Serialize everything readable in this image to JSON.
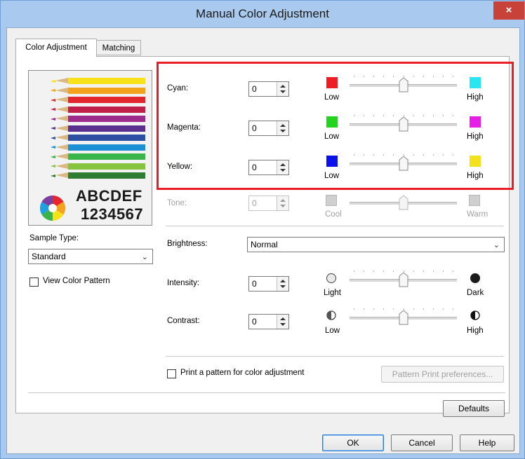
{
  "window": {
    "title": "Manual Color Adjustment",
    "close_label": "×"
  },
  "tabs": [
    {
      "label": "Color Adjustment",
      "active": true
    },
    {
      "label": "Matching",
      "active": false
    }
  ],
  "preview": {
    "sample_text_1": "ABCDEF",
    "sample_text_2": "1234567"
  },
  "sample_type": {
    "label": "Sample Type:",
    "value": "Standard"
  },
  "view_color_pattern": {
    "label": "View Color Pattern",
    "checked": false
  },
  "color_controls": [
    {
      "label": "Cyan:",
      "value": "0",
      "low_label": "Low",
      "high_label": "High",
      "low_color": "#ee1c24",
      "high_color": "#2ae6f0",
      "slider_level": 0.5
    },
    {
      "label": "Magenta:",
      "value": "0",
      "low_label": "Low",
      "high_label": "High",
      "low_color": "#22d41f",
      "high_color": "#e61ee6",
      "slider_level": 0.5
    },
    {
      "label": "Yellow:",
      "value": "0",
      "low_label": "Low",
      "high_label": "High",
      "low_color": "#0a11ea",
      "high_color": "#f2e21c",
      "slider_level": 0.5
    }
  ],
  "tone": {
    "label": "Tone:",
    "value": "0",
    "low_label": "Cool",
    "high_label": "Warm",
    "enabled": false,
    "slider_level": 0.5
  },
  "brightness": {
    "label": "Brightness:",
    "value": "Normal"
  },
  "intensity": {
    "label": "Intensity:",
    "value": "0",
    "low_label": "Light",
    "high_label": "Dark",
    "slider_level": 0.5
  },
  "contrast": {
    "label": "Contrast:",
    "value": "0",
    "low_label": "Low",
    "high_label": "High",
    "slider_level": 0.5
  },
  "print_pattern": {
    "label": "Print a pattern for color adjustment",
    "checked": false
  },
  "buttons": {
    "pattern_print_prefs": "Pattern Print preferences...",
    "defaults": "Defaults",
    "ok": "OK",
    "cancel": "Cancel",
    "help": "Help"
  },
  "colors": {
    "highlight": "#e81d25",
    "title_bar": "#a9c9ee",
    "close_button": "#c7433a"
  }
}
